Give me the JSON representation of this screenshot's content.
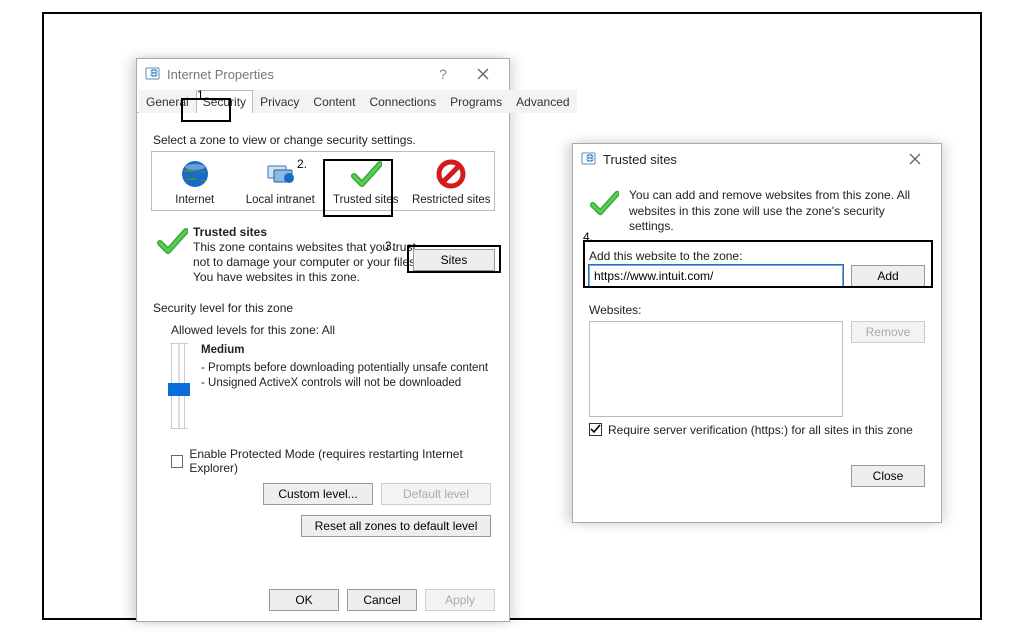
{
  "annotations": {
    "a1": "1.",
    "a2": "2.",
    "a3": "3.",
    "a4": "4."
  },
  "main": {
    "title": "Internet Properties",
    "help": "?",
    "tabs": [
      "General",
      "Security",
      "Privacy",
      "Content",
      "Connections",
      "Programs",
      "Advanced"
    ],
    "active_tab_index": 1,
    "zone_instruction": "Select a zone to view or change security settings.",
    "zones": [
      {
        "label": "Internet"
      },
      {
        "label": "Local intranet"
      },
      {
        "label": "Trusted sites"
      },
      {
        "label": "Restricted sites"
      }
    ],
    "zone_detail": {
      "title": "Trusted sites",
      "desc1": "This zone contains websites that you trust not to damage your computer or your files.",
      "desc2": "You have websites in this zone."
    },
    "sites_btn": "Sites",
    "level_section": "Security level for this zone",
    "allowed_label": "Allowed levels for this zone: All",
    "level": {
      "name": "Medium",
      "line1": "- Prompts before downloading potentially unsafe content",
      "line2": "- Unsigned ActiveX controls will not be downloaded"
    },
    "protected_label": "Enable Protected Mode (requires restarting Internet Explorer)",
    "custom_btn": "Custom level...",
    "default_btn": "Default level",
    "reset_btn": "Reset all zones to default level",
    "ok_btn": "OK",
    "cancel_btn": "Cancel",
    "apply_btn": "Apply"
  },
  "trusted": {
    "title": "Trusted sites",
    "msg": "You can add and remove websites from this zone. All websites in this zone will use the zone's security settings.",
    "add_label": "Add this website to the zone:",
    "url_value": "https://www.intuit.com/",
    "add_btn": "Add",
    "websites_label": "Websites:",
    "remove_btn": "Remove",
    "require_label": "Require server verification (https:) for all sites in this zone",
    "require_checked": true,
    "close_btn": "Close"
  }
}
